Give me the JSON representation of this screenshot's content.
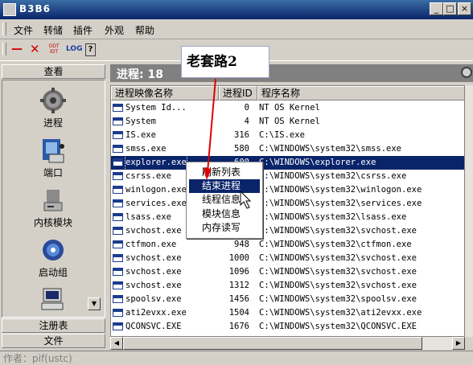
{
  "window": {
    "title": "B3B6",
    "min_label": "_",
    "max_label": "□",
    "close_label": "×"
  },
  "menu": [
    {
      "label": "文件"
    },
    {
      "label": "转储"
    },
    {
      "label": "插件"
    },
    {
      "label": "外观"
    },
    {
      "label": "帮助"
    }
  ],
  "toolbar": {
    "minus": "—",
    "close_x": "✕",
    "odt": "ODT IDT",
    "log": "LOG",
    "help": "?"
  },
  "sidebar": {
    "top_header": "查看",
    "items": [
      {
        "label": "进程"
      },
      {
        "label": "端口"
      },
      {
        "label": "内核模块"
      },
      {
        "label": "启动组"
      }
    ],
    "footer_headers": [
      "注册表",
      "文件"
    ]
  },
  "panel": {
    "title": "进程: 18"
  },
  "columns": [
    "进程映像名称",
    "进程ID",
    "程序名称"
  ],
  "rows": [
    {
      "name": "System Id...",
      "pid": "0",
      "path": "NT OS Kernel"
    },
    {
      "name": "System",
      "pid": "4",
      "path": "NT OS Kernel"
    },
    {
      "name": "IS.exe",
      "pid": "316",
      "path": "C:\\IS.exe"
    },
    {
      "name": "smss.exe",
      "pid": "580",
      "path": "C:\\WINDOWS\\system32\\smss.exe"
    },
    {
      "name": "explorer.exe",
      "pid": "600",
      "path": "C:\\WINDOWS\\explorer.exe"
    },
    {
      "name": "csrss.exe",
      "pid": "",
      "path": "C:\\WINDOWS\\system32\\csrss.exe"
    },
    {
      "name": "winlogon.exe",
      "pid": "",
      "path": "C:\\WINDOWS\\system32\\winlogon.exe"
    },
    {
      "name": "services.exe",
      "pid": "",
      "path": "C:\\WINDOWS\\system32\\services.exe"
    },
    {
      "name": "lsass.exe",
      "pid": "",
      "path": "C:\\WINDOWS\\system32\\lsass.exe"
    },
    {
      "name": "svchost.exe",
      "pid": "",
      "path": "C:\\WINDOWS\\system32\\svchost.exe"
    },
    {
      "name": "ctfmon.exe",
      "pid": "948",
      "path": "C:\\WINDOWS\\system32\\ctfmon.exe"
    },
    {
      "name": "svchost.exe",
      "pid": "1000",
      "path": "C:\\WINDOWS\\system32\\svchost.exe"
    },
    {
      "name": "svchost.exe",
      "pid": "1096",
      "path": "C:\\WINDOWS\\system32\\svchost.exe"
    },
    {
      "name": "svchost.exe",
      "pid": "1312",
      "path": "C:\\WINDOWS\\system32\\svchost.exe"
    },
    {
      "name": "spoolsv.exe",
      "pid": "1456",
      "path": "C:\\WINDOWS\\system32\\spoolsv.exe"
    },
    {
      "name": "ati2evxx.exe",
      "pid": "1504",
      "path": "C:\\WINDOWS\\system32\\ati2evxx.exe"
    },
    {
      "name": "QCONSVC.EXE",
      "pid": "1676",
      "path": "C:\\WINDOWS\\system32\\QCONSVC.EXE"
    }
  ],
  "context_menu": [
    "刷新列表",
    "结束进程",
    "线程信息",
    "模块信息",
    "内存读写"
  ],
  "annotation": {
    "text": "老套路2"
  },
  "status": {
    "text": "作者：pif(ustc)"
  },
  "colors": {
    "selection": "#0a246a",
    "title_bar": "#0a246a",
    "arrow": "#e00000"
  },
  "state": {
    "selected_row": 4,
    "highlighted_menu_item": 1
  }
}
